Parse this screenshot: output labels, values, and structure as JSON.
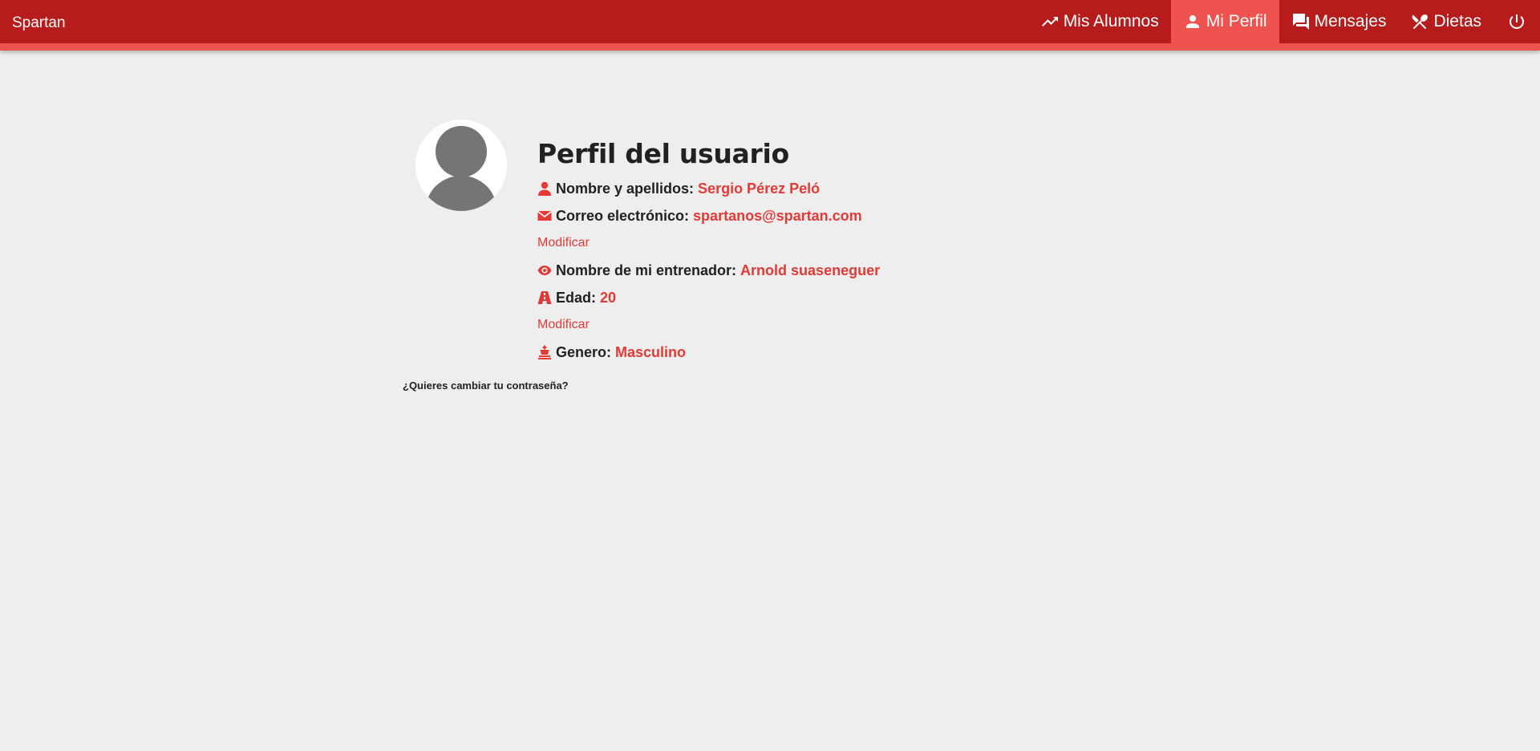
{
  "navbar": {
    "brand": "Spartan",
    "items": [
      {
        "label": "Mis Alumnos",
        "icon": "trending-up-icon"
      },
      {
        "label": "Mi Perfil",
        "icon": "person-icon",
        "active": true
      },
      {
        "label": "Mensajes",
        "icon": "forum-icon"
      },
      {
        "label": "Dietas",
        "icon": "restaurant-icon"
      }
    ],
    "power_icon": "power-icon",
    "colors": {
      "bar": "#b71c1c",
      "accent": "#ef5350"
    }
  },
  "profile": {
    "title": "Perfil del usuario",
    "avatar_icon": "user-avatar-icon",
    "rows": {
      "name": {
        "label": "Nombre y apellidos:",
        "value": "Sergio Pérez Peló",
        "icon": "user-icon"
      },
      "email": {
        "label": "Correo electrónico:",
        "value": "spartanos@spartan.com",
        "icon": "envelope-icon"
      },
      "trainer": {
        "label": "Nombre de mi entrenador:",
        "value": "Arnold suaseneguer",
        "icon": "eye-icon"
      },
      "age": {
        "label": "Edad:",
        "value": "20",
        "icon": "road-icon"
      },
      "gender": {
        "label": "Genero:",
        "value": "Masculino",
        "icon": "chess-king-icon"
      }
    },
    "modify_label": "Modificar",
    "password_link": "¿Quieres cambiar tu contraseña?",
    "value_color": "#e53935"
  }
}
